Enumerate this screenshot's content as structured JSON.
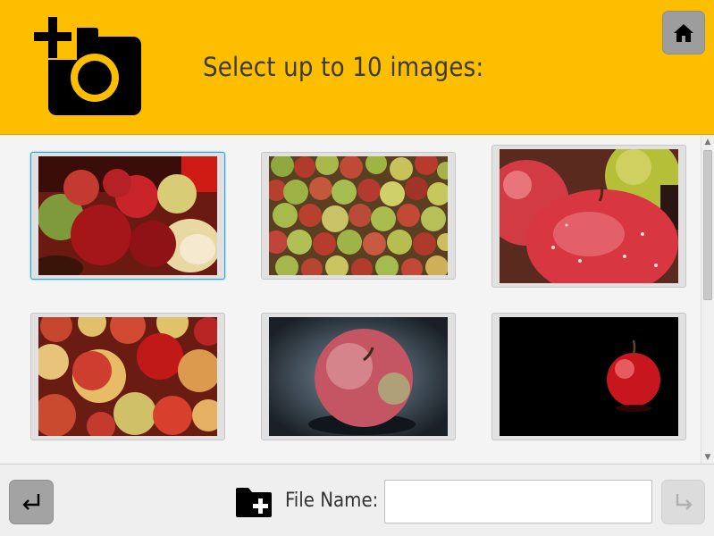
{
  "header": {
    "title": "Select up to 10 images:",
    "icon": "add-photo-camera-icon",
    "home_icon": "home-icon",
    "accent_color": "#fdbe00"
  },
  "gallery": {
    "images": [
      {
        "name": "apples-cut-halves",
        "selected": true
      },
      {
        "name": "apples-pile-green-red",
        "selected": false
      },
      {
        "name": "apples-closeup-wet",
        "selected": false
      },
      {
        "name": "apples-red-yellow-pile",
        "selected": false
      },
      {
        "name": "apple-single-gray-bg",
        "selected": false
      },
      {
        "name": "apple-single-black-bg",
        "selected": false
      }
    ]
  },
  "footer": {
    "back_icon": "return-arrow-icon",
    "folder_icon": "new-folder-icon",
    "file_name_label": "File Name:",
    "file_name_value": "",
    "next_icon": "forward-arrow-icon"
  }
}
